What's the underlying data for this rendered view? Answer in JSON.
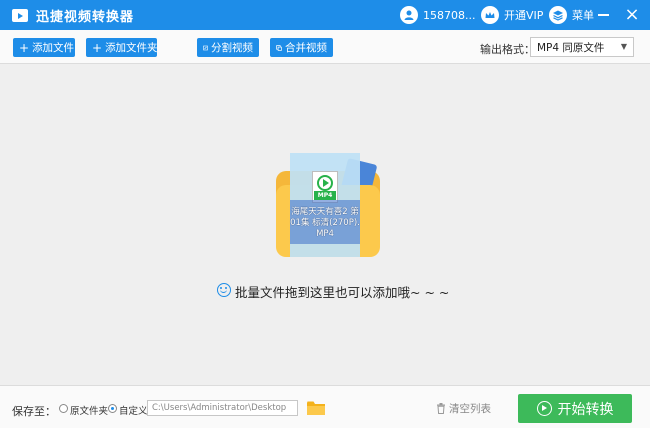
{
  "window": {
    "title": "迅捷视频转换器",
    "user_label": "158708...",
    "vip_label": "开通VIP",
    "menu_label": "菜单",
    "close_glyph": "×"
  },
  "toolbar": {
    "add_file": "添加文件",
    "add_folder": "添加文件夹",
    "split_video": "分割视频",
    "merge_video": "合并视频",
    "plus_glyph": "+",
    "output_format_label": "输出格式：",
    "output_format_value": "MP4  同原文件"
  },
  "main": {
    "drag_file_name": "海尾天天有喜2 第01集 标清(270P).MP4",
    "file_badge": "MP4",
    "hint": "批量文件拖到这里也可以添加哦~ ~ ~"
  },
  "bottom": {
    "save_to_label": "保存至：",
    "option_original": "原文件夹",
    "option_custom": "自定义",
    "selected_option": "自定义",
    "path": "C:\\Users\\Administrator\\Desktop",
    "clear_list": "清空列表",
    "start_convert": "开始转换"
  },
  "colors": {
    "accent_blue": "#1e8de8",
    "start_green": "#3dba5a",
    "folder_yellow": "#fcc94c"
  }
}
